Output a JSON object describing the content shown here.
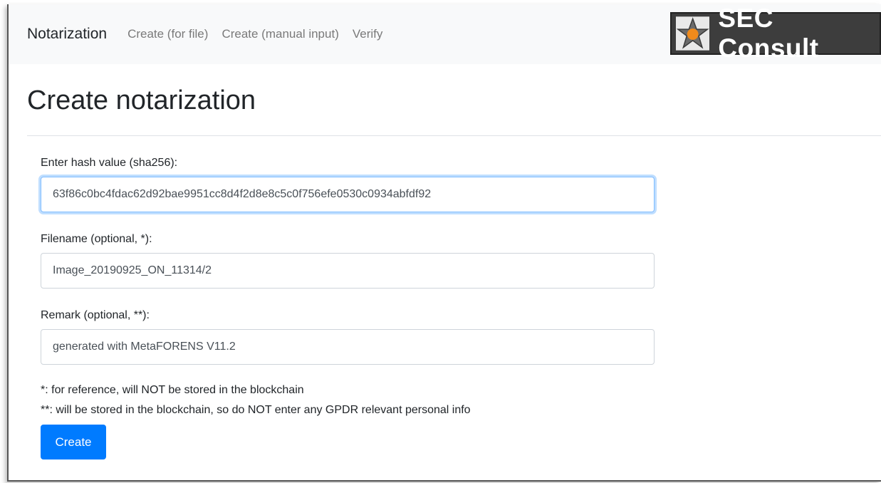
{
  "navbar": {
    "brand": "Notarization",
    "links": [
      "Create (for file)",
      "Create (manual input)",
      "Verify"
    ],
    "logo_text": "SEC Consult"
  },
  "page": {
    "title": "Create notarization"
  },
  "form": {
    "hash_label": "Enter hash value (sha256):",
    "hash_value": "63f86c0bc4fdac62d92bae9951cc8d4f2d8e8c5c0f756efe0530c0934abfdf92",
    "filename_label": "Filename (optional, *):",
    "filename_value": "Image_20190925_ON_11314/2",
    "remark_label": "Remark (optional, **):",
    "remark_value": "generated with MetaFORENS V11.2",
    "note_1": "*: for reference, will NOT be stored in the blockchain",
    "note_2": "**: will be stored in the blockchain, so do NOT enter any GPDR relevant personal info",
    "submit_label": "Create"
  },
  "colors": {
    "primary": "#007bff",
    "navbar_bg": "#f8f9fa",
    "logo_bg": "#3d3d3d",
    "logo_accent": "#f08a1c"
  }
}
